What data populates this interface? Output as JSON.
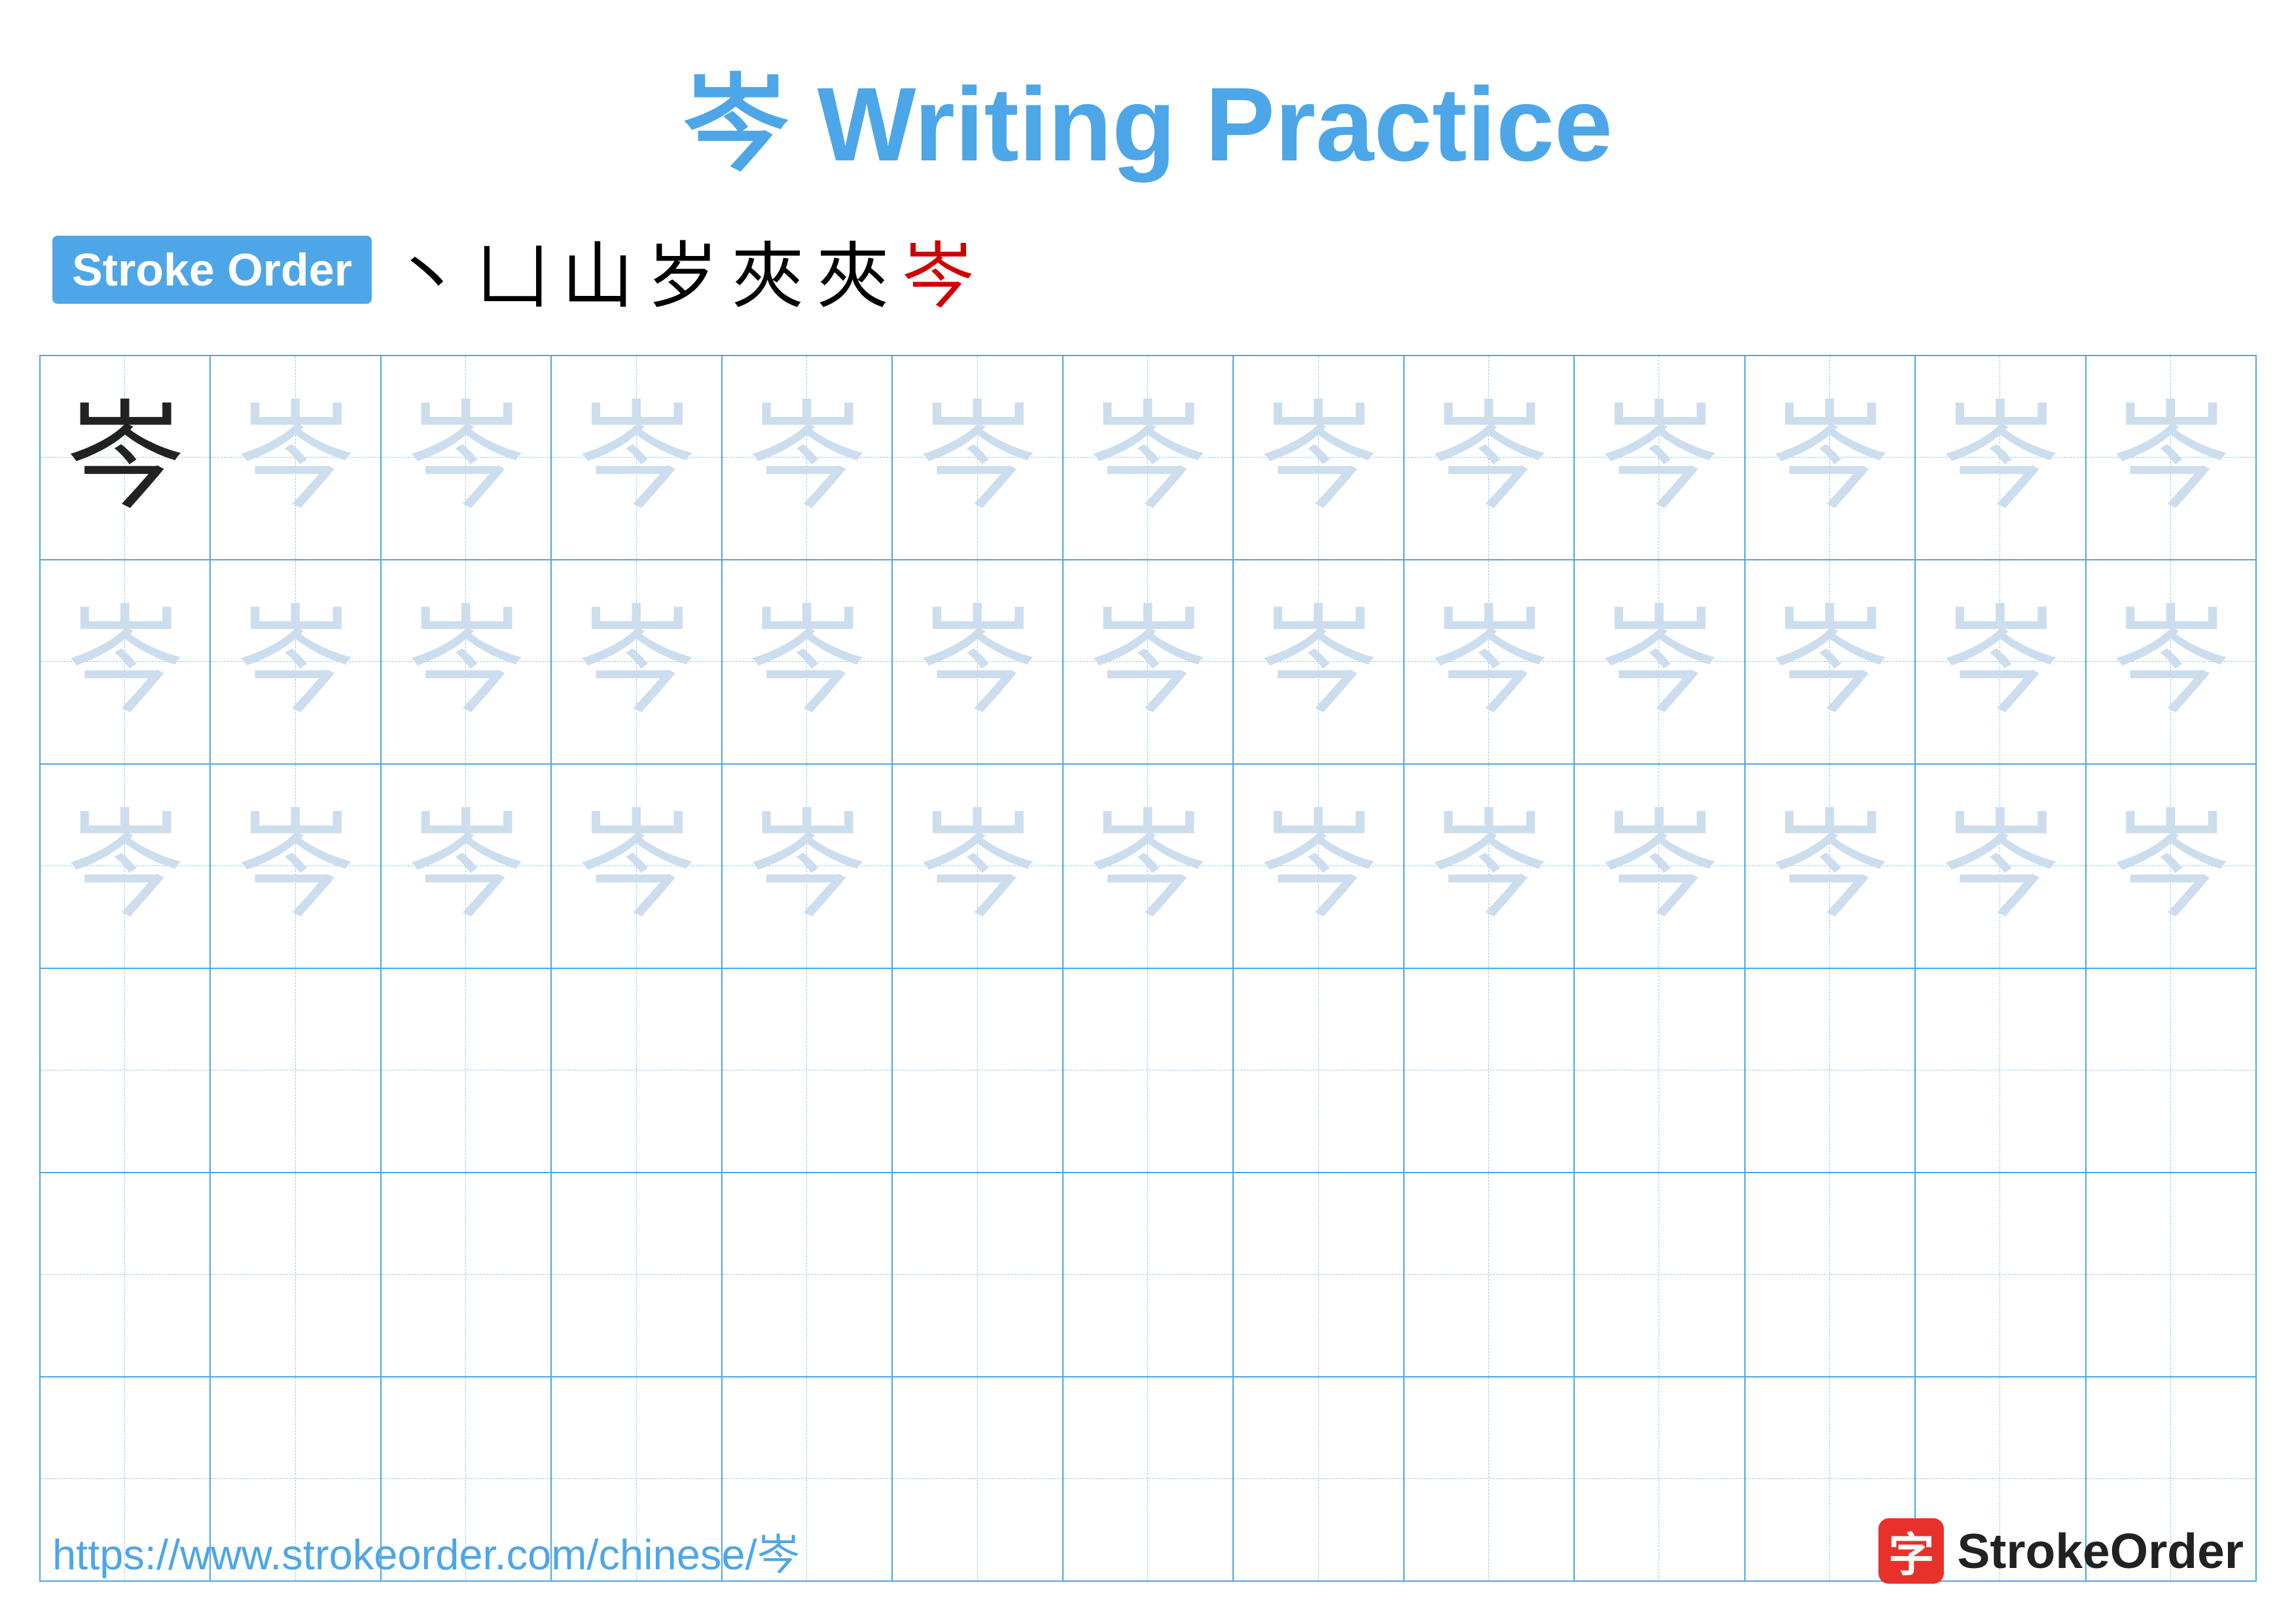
{
  "title": {
    "character": "岑",
    "label": "Writing Practice",
    "full": "岑 Writing Practice"
  },
  "stroke_order": {
    "badge_label": "Stroke Order",
    "strokes": [
      "丶",
      "凵",
      "山",
      "岁",
      "夾",
      "夾",
      "岑"
    ]
  },
  "grid": {
    "rows": 6,
    "cols": 13,
    "character": "岑",
    "solid_row": 0,
    "faint_rows": [
      0,
      1,
      2
    ]
  },
  "footer": {
    "url": "https://www.strokeorder.com/chinese/岑",
    "logo_char": "字",
    "logo_text": "StrokeOrder"
  },
  "colors": {
    "blue": "#4da6e8",
    "red": "#cc0000",
    "faint": "#ccddee",
    "solid": "#222222",
    "white": "#ffffff"
  }
}
